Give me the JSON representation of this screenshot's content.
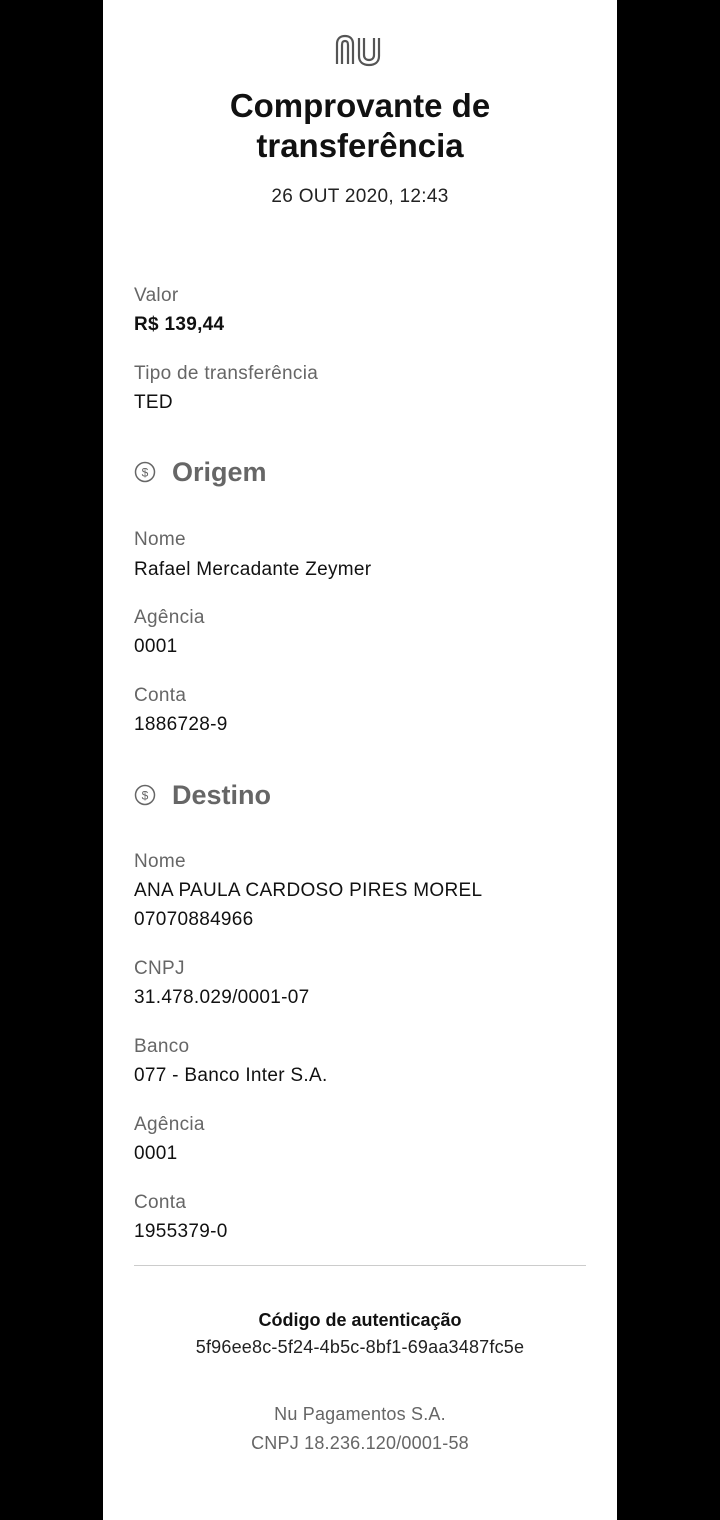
{
  "logo": {
    "icon": "nubank-logo",
    "color": "#555555"
  },
  "header": {
    "title_line1": "Comprovante de",
    "title_line2": "transferência",
    "datetime": "26 OUT 2020, 12:43"
  },
  "summary": {
    "valor_label": "Valor",
    "valor_value": "R$ 139,44",
    "tipo_label": "Tipo de transferência",
    "tipo_value": "TED"
  },
  "origem": {
    "icon": "money-icon",
    "title": "Origem",
    "nome_label": "Nome",
    "nome_value": "Rafael Mercadante Zeymer",
    "agencia_label": "Agência",
    "agencia_value": "0001",
    "conta_label": "Conta",
    "conta_value": "1886728-9"
  },
  "destino": {
    "icon": "money-icon",
    "title": "Destino",
    "nome_label": "Nome",
    "nome_line1": "ANA PAULA CARDOSO PIRES MOREL",
    "nome_line2": "07070884966",
    "cnpj_label": "CNPJ",
    "cnpj_value": "31.478.029/0001-07",
    "banco_label": "Banco",
    "banco_value": "077 - Banco Inter S.A.",
    "agencia_label": "Agência",
    "agencia_value": "0001",
    "conta_label": "Conta",
    "conta_value": "1955379-0"
  },
  "auth": {
    "title": "Código de autenticação",
    "code": "5f96ee8c-5f24-4b5c-8bf1-69aa3487fc5e"
  },
  "footer": {
    "company": "Nu Pagamentos S.A.",
    "cnpj": "CNPJ 18.236.120/0001-58"
  }
}
